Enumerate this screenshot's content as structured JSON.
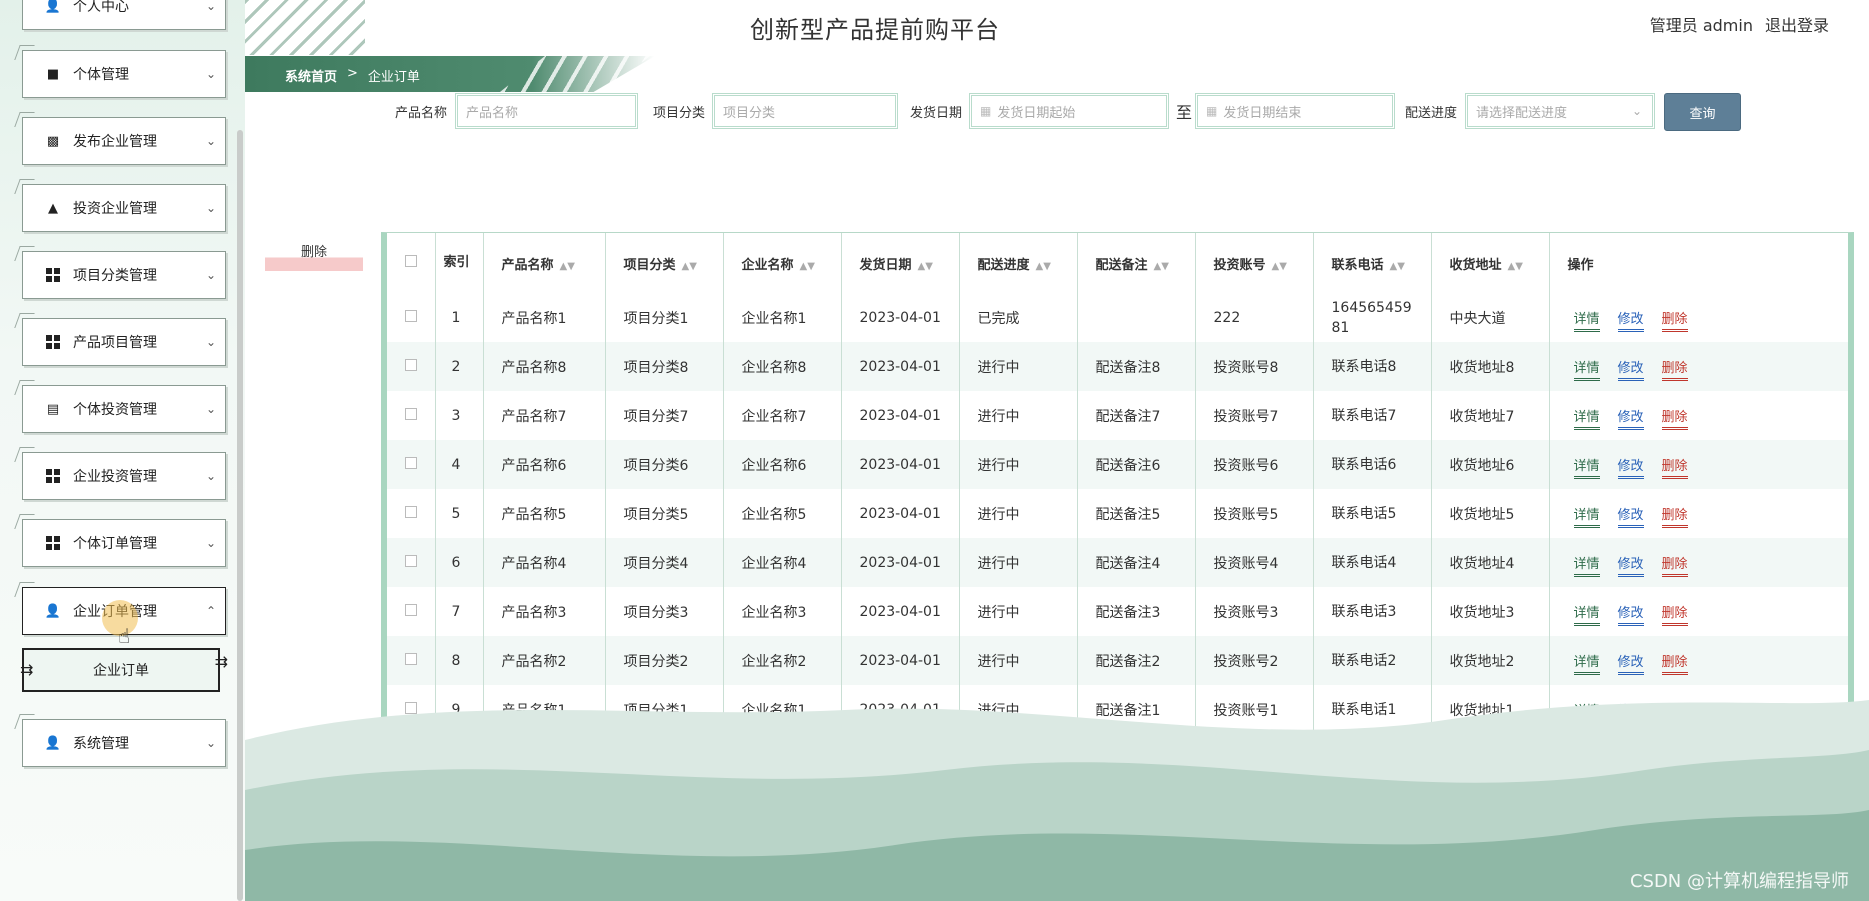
{
  "sidebar": {
    "items": [
      {
        "label": "个人中心",
        "icon": "user-icon"
      },
      {
        "label": "个体管理",
        "icon": "monitor-icon"
      },
      {
        "label": "发布企业管理",
        "icon": "clipboard-icon"
      },
      {
        "label": "投资企业管理",
        "icon": "stamp-icon"
      },
      {
        "label": "项目分类管理",
        "icon": "grid-icon"
      },
      {
        "label": "产品项目管理",
        "icon": "grid-icon"
      },
      {
        "label": "个体投资管理",
        "icon": "chart-icon"
      },
      {
        "label": "企业投资管理",
        "icon": "grid-icon"
      },
      {
        "label": "个体订单管理",
        "icon": "grid-icon"
      },
      {
        "label": "企业订单管理",
        "icon": "user-icon"
      },
      {
        "label": "系统管理",
        "icon": "user-icon"
      }
    ],
    "submenu_label": "企业订单"
  },
  "header": {
    "title": "创新型产品提前购平台",
    "user_label": "管理员 admin",
    "logout_label": "退出登录"
  },
  "breadcrumb": {
    "home": "系统首页",
    "separator": ">",
    "current": "企业订单"
  },
  "search": {
    "product_name_label": "产品名称",
    "product_name_placeholder": "产品名称",
    "category_label": "项目分类",
    "category_placeholder": "项目分类",
    "ship_date_label": "发货日期",
    "ship_date_start_placeholder": "发货日期起始",
    "to_label": "至",
    "ship_date_end_placeholder": "发货日期结束",
    "progress_label": "配送进度",
    "progress_placeholder": "请选择配送进度",
    "query_label": "查询"
  },
  "delete_label": "删除",
  "table": {
    "headers": [
      "索引",
      "产品名称",
      "项目分类",
      "企业名称",
      "发货日期",
      "配送进度",
      "配送备注",
      "投资账号",
      "联系电话",
      "收货地址",
      "操作"
    ],
    "rows": [
      [
        "1",
        "产品名称1",
        "项目分类1",
        "企业名称1",
        "2023-04-01",
        "已完成",
        "",
        "222",
        "16456545981",
        "中央大道"
      ],
      [
        "2",
        "产品名称8",
        "项目分类8",
        "企业名称8",
        "2023-04-01",
        "进行中",
        "配送备注8",
        "投资账号8",
        "联系电话8",
        "收货地址8"
      ],
      [
        "3",
        "产品名称7",
        "项目分类7",
        "企业名称7",
        "2023-04-01",
        "进行中",
        "配送备注7",
        "投资账号7",
        "联系电话7",
        "收货地址7"
      ],
      [
        "4",
        "产品名称6",
        "项目分类6",
        "企业名称6",
        "2023-04-01",
        "进行中",
        "配送备注6",
        "投资账号6",
        "联系电话6",
        "收货地址6"
      ],
      [
        "5",
        "产品名称5",
        "项目分类5",
        "企业名称5",
        "2023-04-01",
        "进行中",
        "配送备注5",
        "投资账号5",
        "联系电话5",
        "收货地址5"
      ],
      [
        "6",
        "产品名称4",
        "项目分类4",
        "企业名称4",
        "2023-04-01",
        "进行中",
        "配送备注4",
        "投资账号4",
        "联系电话4",
        "收货地址4"
      ],
      [
        "7",
        "产品名称3",
        "项目分类3",
        "企业名称3",
        "2023-04-01",
        "进行中",
        "配送备注3",
        "投资账号3",
        "联系电话3",
        "收货地址3"
      ],
      [
        "8",
        "产品名称2",
        "项目分类2",
        "企业名称2",
        "2023-04-01",
        "进行中",
        "配送备注2",
        "投资账号2",
        "联系电话2",
        "收货地址2"
      ],
      [
        "9",
        "产品名称1",
        "项目分类1",
        "企业名称1",
        "2023-04-01",
        "进行中",
        "配送备注1",
        "投资账号1",
        "联系电话1",
        "收货地址1"
      ]
    ],
    "actions": {
      "detail": "详情",
      "edit": "修改",
      "delete": "删除"
    }
  },
  "watermark": "CSDN @计算机编程指导师",
  "colors": {
    "accent_green": "#3e7a5e",
    "query_button": "#5e7f97",
    "detail_link": "#2e6b4a",
    "edit_link": "#2a62b8",
    "delete_link": "#c0362c"
  }
}
